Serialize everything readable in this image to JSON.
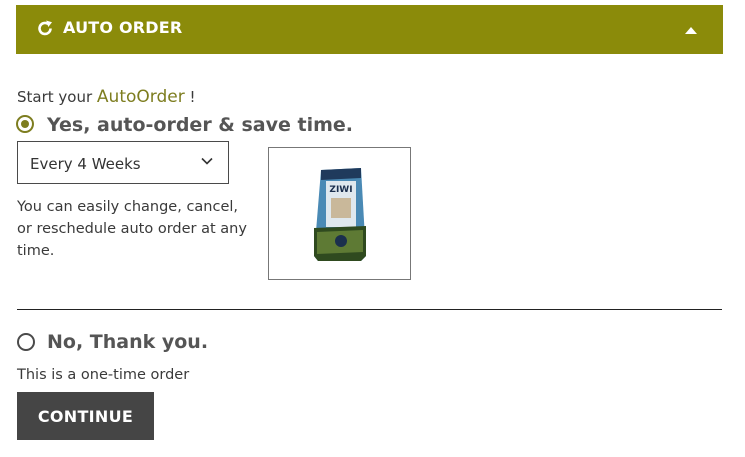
{
  "header": {
    "title": "AUTO ORDER",
    "icon": "refresh-icon",
    "toggle_icon": "caret-up-icon",
    "bg_color": "#8b8b0a"
  },
  "intro": {
    "prefix": "Start your ",
    "accent": "AutoOrder",
    "suffix": " !",
    "accent_color": "#7d7d1f"
  },
  "option_yes": {
    "label": "Yes, auto-order & save time.",
    "selected": true
  },
  "frequency": {
    "selected": "Every 4 Weeks"
  },
  "help_text": "You can easily change, cancel, or reschedule auto order at any time.",
  "product": {
    "image": "ziwi-peak-pet-food-bag-image",
    "brand": "ZIWI"
  },
  "option_no": {
    "label": "No, Thank you.",
    "selected": false
  },
  "one_time_text": "This is a one-time order",
  "continue_label": "CONTINUE"
}
